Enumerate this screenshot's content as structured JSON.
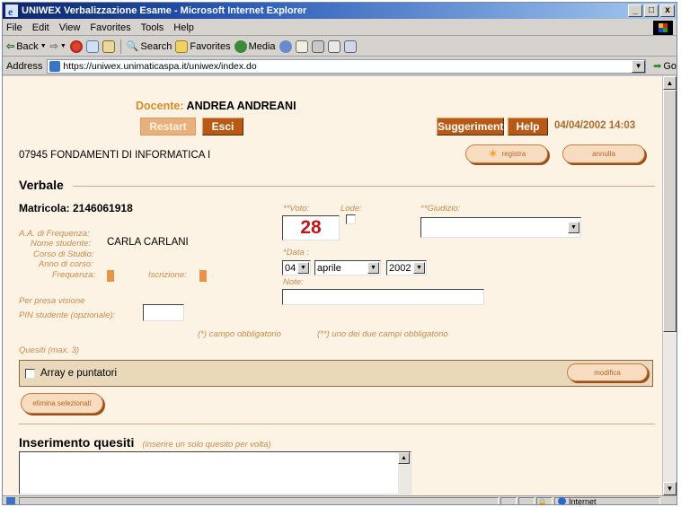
{
  "window": {
    "title": "UNIWEX Verbalizzazione Esame - Microsoft Internet Explorer",
    "buttons": [
      "_",
      "□",
      "x"
    ]
  },
  "menu": [
    "File",
    "Edit",
    "View",
    "Favorites",
    "Tools",
    "Help"
  ],
  "toolbar": {
    "back": "Back",
    "search": "Search",
    "favorites": "Favorites",
    "media": "Media"
  },
  "address": {
    "label": "Address",
    "url": "https://uniwex.unimaticaspa.it/uniwex/index.do",
    "go": "Go"
  },
  "header": {
    "docente_label": "Docente:",
    "docente_name": "ANDREA ANDREANI",
    "restart": "Restart",
    "esci": "Esci",
    "suggerimenti": "Suggerimenti",
    "help": "Help",
    "datetime": "04/04/2002 14:03"
  },
  "course": {
    "name": "07945 FONDAMENTI DI INFORMATICA I",
    "registra": "registra",
    "annulla": "annulla"
  },
  "verbale": {
    "title": "Verbale",
    "matricola": "Matricola: 2146061918",
    "aa_label": "A.A. di Frequenza:",
    "nome_label": "Nome studente:",
    "nome_value": "CARLA CARLANI",
    "corso_label": "Corso di Studio:",
    "anno_label": "Anno di corso:",
    "frequenza_label": "Frequenza:",
    "iscrizione_label": "Iscrizione:",
    "presa_label": "Per presa visione",
    "pin_label": "PIN studente (opzionale):",
    "voto_label": "**Voto:",
    "voto_value": "28",
    "lode_label": "Lode:",
    "giudizio_label": "**Giudizio:",
    "data_label": "*Data :",
    "day": "04",
    "month": "aprile",
    "year": "2002",
    "note_label": "Note:",
    "legend1": "(*) campo obbligatorio",
    "legend2": "(**) uno dei due campi obbligatorio"
  },
  "quesiti": {
    "label": "Quesiti (max. 3)",
    "items": [
      {
        "label": "Array e puntatori",
        "checked": false
      }
    ],
    "modifica": "modifica",
    "elimina": "elimina selezionati"
  },
  "inserimento": {
    "title": "Inserimento quesiti",
    "hint": "(inserire un solo quesito per volta)"
  },
  "status": {
    "zone": "Internet"
  }
}
